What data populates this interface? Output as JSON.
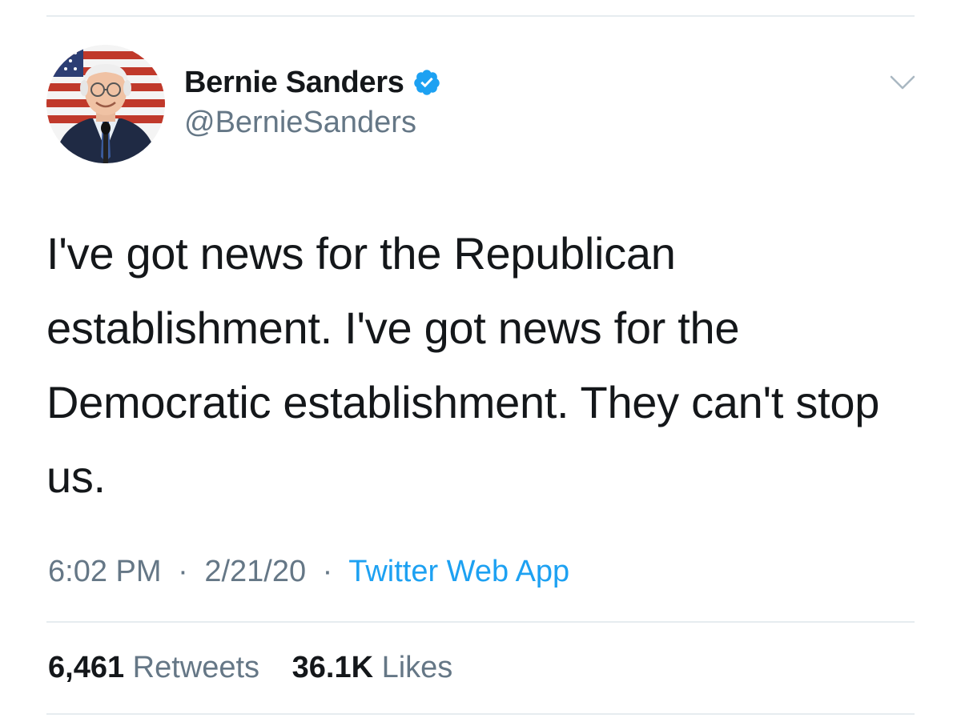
{
  "tweet": {
    "author": {
      "display_name": "Bernie Sanders",
      "handle": "@BernieSanders",
      "verified": true,
      "avatar_icon": "profile-photo"
    },
    "text": "I've got news for the Republican establishment. I've got news for the Democratic establishment. They can't stop us.",
    "time": "6:02 PM",
    "date": "2/21/20",
    "separator": "·",
    "source": "Twitter Web App",
    "retweets": {
      "count": "6,461",
      "label": "Retweets"
    },
    "likes": {
      "count": "36.1K",
      "label": "Likes"
    }
  },
  "colors": {
    "text": "#14171a",
    "secondary": "#657786",
    "link": "#1da1f2",
    "divider": "#e6ecf0",
    "verified": "#1da1f2"
  },
  "icons": {
    "verified": "verified-badge-icon",
    "menu": "chevron-down-icon"
  }
}
